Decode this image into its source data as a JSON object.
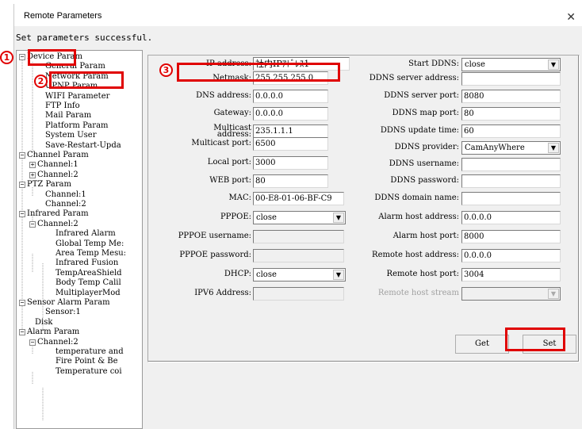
{
  "window": {
    "title": "Remote Parameters",
    "status": "Set parameters successful."
  },
  "markers": [
    "1",
    "2",
    "3"
  ],
  "tree": [
    "Device Param",
    "General Param",
    "Network Param",
    "UPNP Param",
    "WIFI Parameter",
    "FTP Info",
    "Mail Param",
    "Platform Param",
    "System User",
    "Save-Restart-Upda",
    "Channel Param",
    "Channel:1",
    "Channel:2",
    "PTZ Param",
    "Channel:1",
    "Channel:2",
    "Infrared Param",
    "Channel:2",
    "Infrared Alarm",
    "Global Temp Me:",
    "Area Temp Mesu:",
    "Infrared Fusion",
    "TempAreaShield",
    "Body Temp Calil",
    "MultiplayerMod",
    "Sensor Alarm Param",
    "Sensor:1",
    "Disk",
    "Alarm Param",
    "Channel:2",
    "temperature and",
    "Fire Point & Be",
    "Temperature coi"
  ],
  "form": {
    "left": {
      "ip_label": "IP address:",
      "ip_value": "社内IPｱﾄﾞﾚｽ1",
      "netmask_label": "Netmask:",
      "netmask_value": "255.255.255.0",
      "dns_label": "DNS address:",
      "dns_value": "0.0.0.0",
      "gateway_label": "Gateway:",
      "gateway_value": "0.0.0.0",
      "multicast_label": "Multicast",
      "multicast_label2": "address:",
      "multicast_value": "235.1.1.1",
      "mport_label": "Multicast port:",
      "mport_value": "6500",
      "lport_label": "Local port:",
      "lport_value": "3000",
      "web_label": "WEB port:",
      "web_value": "80",
      "mac_label": "MAC:",
      "mac_value": "00-E8-01-06-BF-C9",
      "pppoe_label": "PPPOE:",
      "pppoe_value": "close",
      "pppoe_user_label": "PPPOE username:",
      "pppoe_user_value": "",
      "pppoe_pass_label": "PPPOE password:",
      "pppoe_pass_value": "",
      "dhcp_label": "DHCP:",
      "dhcp_value": "close",
      "ipv6_label": "IPV6 Address:",
      "ipv6_value": ""
    },
    "right": {
      "ddns_label": "Start DDNS:",
      "ddns_value": "close",
      "ddns_server_label": "DDNS server address:",
      "ddns_server_value": "",
      "ddns_port_label": "DDNS server port:",
      "ddns_port_value": "8080",
      "ddns_map_label": "DDNS map port:",
      "ddns_map_value": "80",
      "ddns_update_label": "DDNS update time:",
      "ddns_update_value": "60",
      "ddns_provider_label": "DDNS provider:",
      "ddns_provider_value": "CamAnyWhere",
      "ddns_user_label": "DDNS username:",
      "ddns_user_value": "",
      "ddns_pass_label": "DDNS password:",
      "ddns_pass_value": "",
      "ddns_domain_label": "DDNS domain name:",
      "ddns_domain_value": "",
      "alarm_addr_label": "Alarm host address:",
      "alarm_addr_value": "0.0.0.0",
      "alarm_port_label": "Alarm host port:",
      "alarm_port_value": "8000",
      "remote_addr_label": "Remote host address:",
      "remote_addr_value": "0.0.0.0",
      "remote_port_label": "Remote host port:",
      "remote_port_value": "3004",
      "remote_stream_label": "Remote host stream",
      "remote_stream_value": ""
    }
  },
  "buttons": {
    "get": "Get",
    "set": "Set"
  },
  "colors": {
    "highlight": "#e00000",
    "window_bg": "#f0f0f0"
  }
}
